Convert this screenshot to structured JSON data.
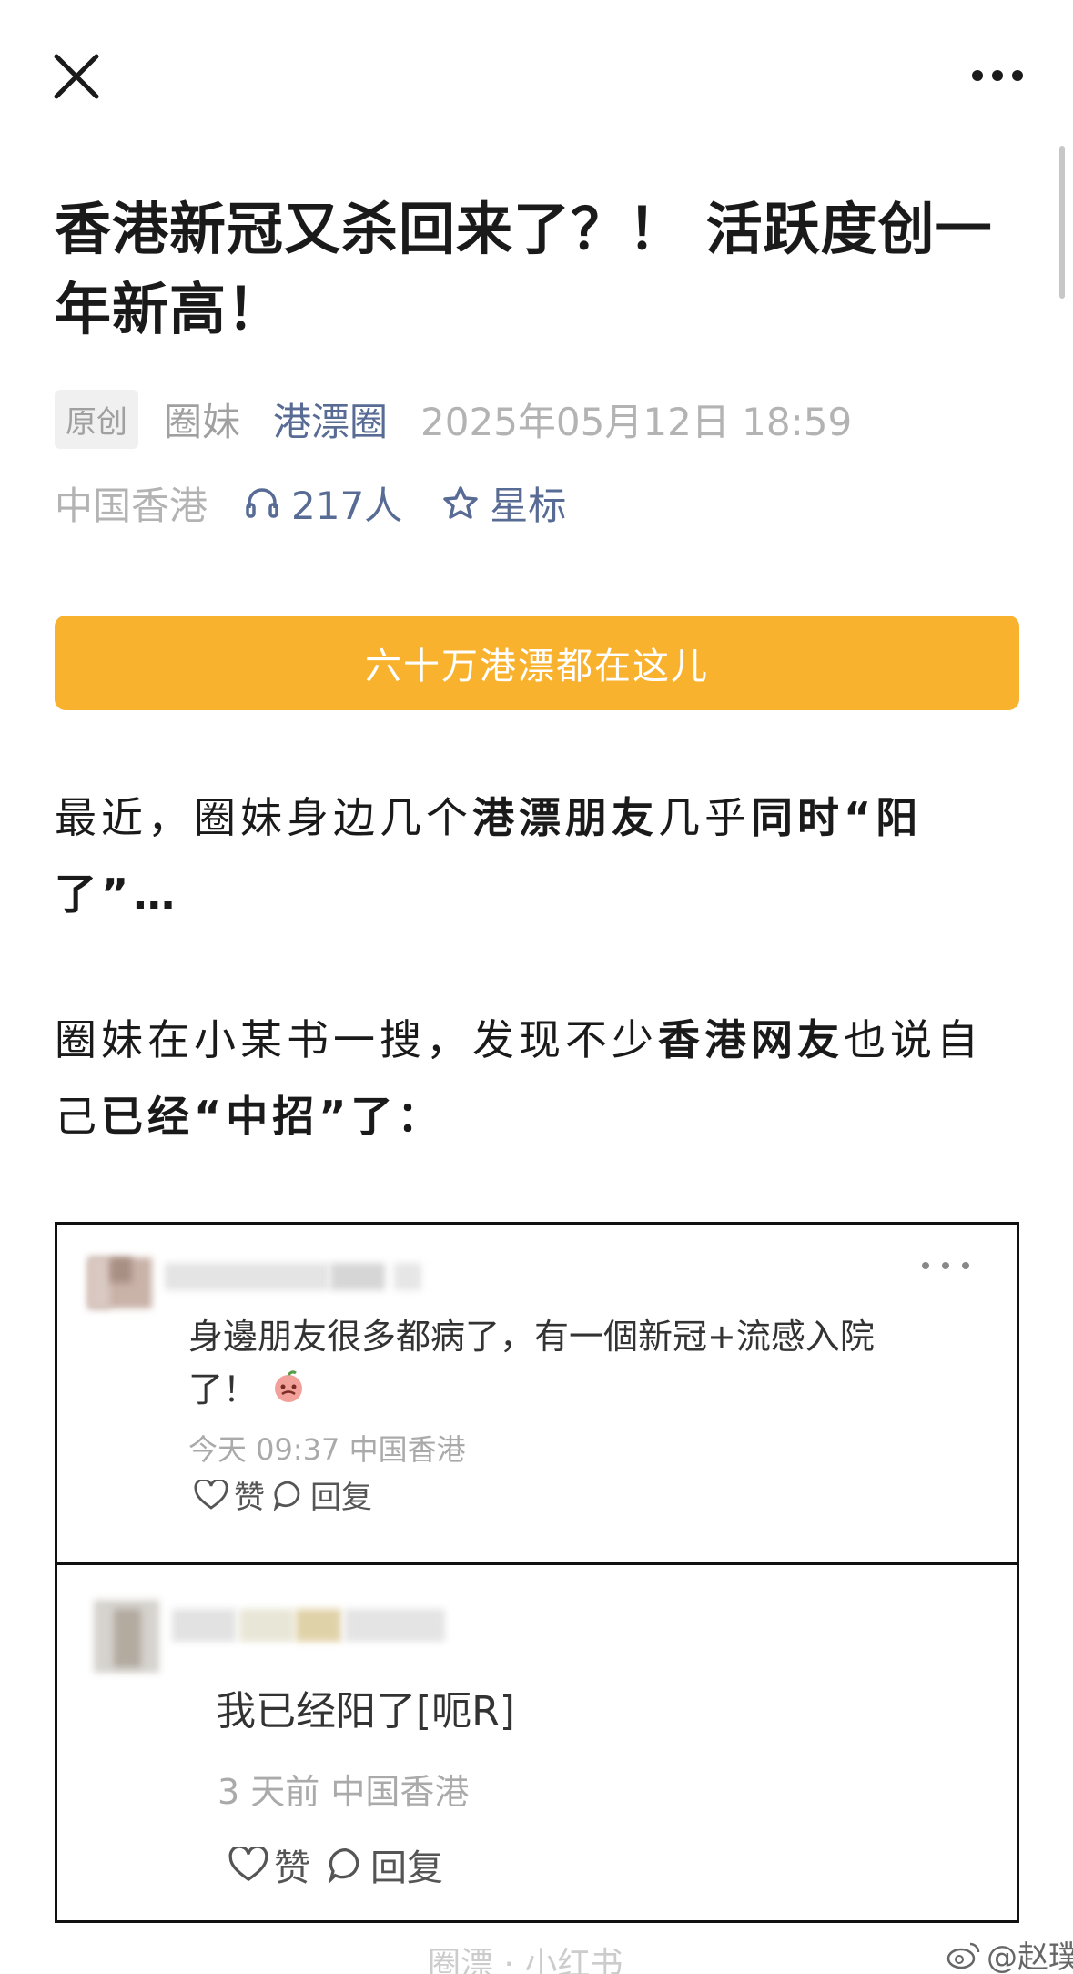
{
  "article": {
    "title": "香港新冠又杀回来了？！ 活跃度创一年新高！",
    "badge": "原创",
    "author": "圈妹",
    "account": "港漂圈",
    "datetime": "2025年05月12日 18:59",
    "location": "中国香港",
    "listen_count": "217人",
    "star_label": "星标",
    "banner": "六十万港漂都在这儿",
    "p1": {
      "a": "最近，圈妹身边几个",
      "b": "港漂朋友",
      "c": "几乎",
      "d": "同时“阳了”…"
    },
    "p2": {
      "a": "圈妹在小某书一搜，发现不少",
      "b": "香港网友",
      "c": "也说自己",
      "d": "已经“中招”了："
    }
  },
  "comments": [
    {
      "text_line1": "身邊朋友很多都病了，有一個新冠+流感入院",
      "text_line2": "了！",
      "meta": "今天 09:37 中国香港",
      "like": "赞",
      "reply": "回复"
    },
    {
      "text": "我已经阳了[呃R]",
      "meta": "3 天前 中国香港",
      "like": "赞",
      "reply": "回复"
    }
  ],
  "footer": {
    "partial_text": "圈漂 · 小红书",
    "watermark": "@赵璞"
  },
  "colors": {
    "link": "#576b95",
    "banner": "#f9b22e",
    "muted": "#b3b3b3"
  },
  "icons": [
    "close-icon",
    "more-icon",
    "headphones-icon",
    "star-icon",
    "emoji-icon",
    "heart-icon",
    "comment-icon",
    "weibo-icon"
  ]
}
